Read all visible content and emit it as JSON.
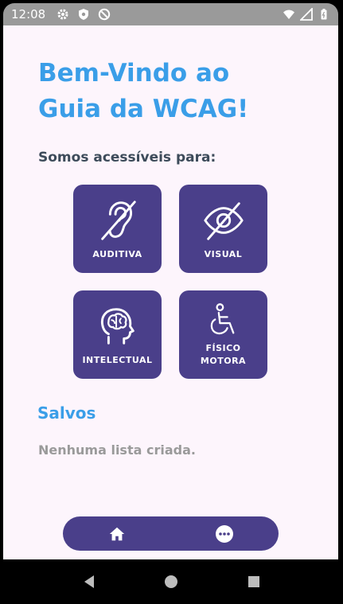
{
  "statusbar": {
    "time": "12:08"
  },
  "header": {
    "title_line1": "Bem-Vindo ao",
    "title_line2": "Guia da WCAG!"
  },
  "intro": {
    "subtitle": "Somos acessíveis para:"
  },
  "categories": [
    {
      "label": "AUDITIVA",
      "icon": "ear-crossed-icon"
    },
    {
      "label": "VISUAL",
      "icon": "eye-crossed-icon"
    },
    {
      "label": "INTELECTUAL",
      "icon": "brain-head-icon"
    },
    {
      "label_line1": "FÍSICO",
      "label_line2": "MOTORA",
      "icon": "wheelchair-icon"
    }
  ],
  "saved": {
    "title": "Salvos",
    "empty_message": "Nenhuma lista criada."
  },
  "colors": {
    "accent": "#3a9ee8",
    "tile": "#4a3f8a",
    "background": "#fdf5fc"
  }
}
